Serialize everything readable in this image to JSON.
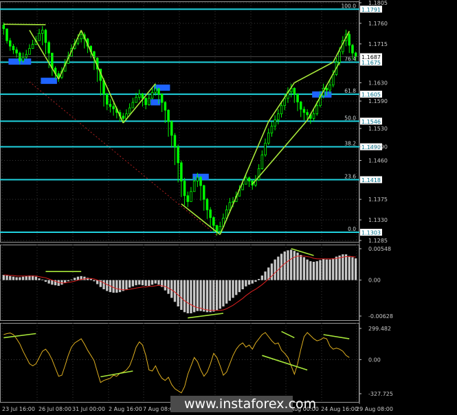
{
  "colors": {
    "background": "#000000",
    "fib_level": "#20d4e0",
    "price_tag_bg": "#ffffff",
    "price_tag_text": "#00708a",
    "candles": "#00ff00",
    "trendlines": "#a8e83a",
    "macd_hist": "#c8c8c8",
    "macd_signal": "#e02020",
    "cci": "#e0b020",
    "block": "#1e64ff"
  },
  "watermark": "www.instaforex.com",
  "chart_data": [
    {
      "type": "candlestick",
      "pane": "price",
      "ylim": [
        1.1285,
        1.1805
      ],
      "y_ticks": [
        "1.1805",
        "1.1760",
        "1.1715",
        "1.1630",
        "1.1590",
        "1.1530",
        "1.1490",
        "1.1460",
        "1.1375",
        "1.1330",
        "1.1285"
      ],
      "x_ticks": [
        "23 Jul 16:00",
        "26 Jul 08:00",
        "31 Jul 00:00",
        "2 Aug 16:00",
        "7 Aug 08:00",
        "9 Aug 16:00",
        "14 Aug 08:00",
        "17 Aug 00:00",
        "22 Aug 00:00",
        "24 Aug 16:00",
        "29 Aug 08:00"
      ],
      "x_tick_labels_visible": [
        "23 Jul 16:00",
        "26 Jul 08:00",
        "31 Jul 00:00",
        "2 Aug 16:00",
        "7 Aug 08:00",
        "2 Aug 00:00",
        "24 Aug 16:00",
        "29 Aug 08:00"
      ],
      "fib_levels": [
        {
          "label": "100.0",
          "price": 1.1791,
          "tag": "1.1791"
        },
        {
          "label": "76.4",
          "price": 1.1675,
          "tag": "1.1675"
        },
        {
          "label": "61.8",
          "price": 1.1605,
          "tag": "1.1605"
        },
        {
          "label": "50.0",
          "price": 1.1546,
          "tag": "1.1546"
        },
        {
          "label": "38.2",
          "price": 1.149,
          "tag": "1.1490"
        },
        {
          "label": "23.6",
          "price": 1.1418,
          "tag": "1.1418"
        },
        {
          "label": "0.0",
          "price": 1.1303,
          "tag": "1.1303"
        }
      ],
      "current_price": {
        "tag": "1.1687",
        "price": 1.1687
      },
      "close_series": [
        1.1748,
        1.1722,
        1.171,
        1.1702,
        1.1695,
        1.1678,
        1.1686,
        1.1692,
        1.1705,
        1.1714,
        1.1722,
        1.1738,
        1.1745,
        1.1718,
        1.1695,
        1.1662,
        1.165,
        1.1642,
        1.1655,
        1.1672,
        1.1688,
        1.1705,
        1.1716,
        1.1726,
        1.1735,
        1.1726,
        1.171,
        1.1698,
        1.1684,
        1.166,
        1.1635,
        1.1605,
        1.1583,
        1.1578,
        1.1573,
        1.1565,
        1.1557,
        1.1552,
        1.1562,
        1.1575,
        1.1587,
        1.1598,
        1.1605,
        1.1596,
        1.1582,
        1.1596,
        1.1609,
        1.1617,
        1.1605,
        1.1587,
        1.157,
        1.1545,
        1.1515,
        1.149,
        1.1455,
        1.1415,
        1.1383,
        1.137,
        1.1392,
        1.1415,
        1.1423,
        1.1405,
        1.1375,
        1.1352,
        1.1335,
        1.1318,
        1.1305,
        1.1316,
        1.1334,
        1.1352,
        1.1368,
        1.137,
        1.1382,
        1.1396,
        1.1408,
        1.1422,
        1.1415,
        1.1406,
        1.1418,
        1.1442,
        1.1472,
        1.1498,
        1.152,
        1.1535,
        1.1549,
        1.1562,
        1.158,
        1.1596,
        1.161,
        1.1618,
        1.1605,
        1.1588,
        1.1572,
        1.1565,
        1.156,
        1.1552,
        1.1562,
        1.158,
        1.1602,
        1.1618,
        1.1614,
        1.1625,
        1.1648,
        1.1675,
        1.1698,
        1.1722,
        1.1736,
        1.1712,
        1.1695,
        1.1688
      ],
      "high_series": [
        1.1762,
        1.1748,
        1.1728,
        1.1715,
        1.1708,
        1.1698,
        1.1696,
        1.1702,
        1.1714,
        1.1724,
        1.1732,
        1.1748,
        1.1754,
        1.1748,
        1.1722,
        1.1695,
        1.1666,
        1.1656,
        1.1664,
        1.1682,
        1.1698,
        1.1714,
        1.1726,
        1.1736,
        1.1745,
        1.174,
        1.1728,
        1.1712,
        1.17,
        1.1686,
        1.166,
        1.164,
        1.1608,
        1.1594,
        1.1586,
        1.1578,
        1.1571,
        1.1564,
        1.1572,
        1.1585,
        1.1597,
        1.1608,
        1.1615,
        1.1608,
        1.1598,
        1.1606,
        1.1619,
        1.1627,
        1.1619,
        1.1607,
        1.159,
        1.1572,
        1.1548,
        1.152,
        1.1495,
        1.146,
        1.1422,
        1.1392,
        1.1402,
        1.1425,
        1.1433,
        1.1426,
        1.1407,
        1.1378,
        1.1358,
        1.1338,
        1.1318,
        1.1326,
        1.1344,
        1.1362,
        1.1378,
        1.138,
        1.1392,
        1.1406,
        1.1418,
        1.1432,
        1.1425,
        1.1418,
        1.1428,
        1.1452,
        1.1482,
        1.1508,
        1.153,
        1.1545,
        1.1559,
        1.1572,
        1.159,
        1.1606,
        1.162,
        1.1628,
        1.162,
        1.1607,
        1.159,
        1.1578,
        1.1572,
        1.1564,
        1.1572,
        1.159,
        1.1612,
        1.1628,
        1.1626,
        1.1635,
        1.1658,
        1.1685,
        1.1708,
        1.1732,
        1.1746,
        1.174,
        1.1715,
        1.1698
      ],
      "low_series": [
        1.1735,
        1.1716,
        1.17,
        1.1693,
        1.1685,
        1.167,
        1.1674,
        1.1682,
        1.1694,
        1.1704,
        1.1712,
        1.1725,
        1.1712,
        1.1692,
        1.1662,
        1.1645,
        1.1638,
        1.1632,
        1.1638,
        1.1658,
        1.1674,
        1.169,
        1.1702,
        1.1712,
        1.1718,
        1.1705,
        1.1695,
        1.1684,
        1.1658,
        1.1632,
        1.1602,
        1.1578,
        1.157,
        1.1565,
        1.1558,
        1.1552,
        1.1545,
        1.1542,
        1.1548,
        1.1562,
        1.1575,
        1.1586,
        1.1592,
        1.1578,
        1.1572,
        1.158,
        1.1594,
        1.1602,
        1.1584,
        1.1566,
        1.1542,
        1.1512,
        1.1488,
        1.145,
        1.1412,
        1.138,
        1.1362,
        1.1358,
        1.137,
        1.1392,
        1.1402,
        1.1372,
        1.135,
        1.1332,
        1.1315,
        1.1303,
        1.1296,
        1.1302,
        1.1312,
        1.1328,
        1.1345,
        1.1358,
        1.137,
        1.1382,
        1.1395,
        1.1408,
        1.1402,
        1.1396,
        1.1402,
        1.1415,
        1.144,
        1.1468,
        1.1494,
        1.1512,
        1.1526,
        1.1539,
        1.1554,
        1.157,
        1.1586,
        1.1598,
        1.1586,
        1.1568,
        1.1555,
        1.1548,
        1.1546,
        1.154,
        1.1546,
        1.1558,
        1.1576,
        1.1596,
        1.1602,
        1.1606,
        1.162,
        1.1645,
        1.1668,
        1.1692,
        1.171,
        1.1695,
        1.1682,
        1.1678
      ]
    },
    {
      "type": "bar",
      "pane": "macd",
      "ylim": [
        -0.00628,
        0.00548
      ],
      "y_ticks": [
        "0.00548",
        "0.00",
        "-0.00628"
      ],
      "histogram": [
        0.0009,
        0.0008,
        0.0007,
        0.0006,
        0.0005,
        0.0005,
        0.0006,
        0.0007,
        0.0008,
        0.0008,
        0.0006,
        0.0003,
        0.0001,
        -0.0003,
        -0.0006,
        -0.0008,
        -0.0009,
        -0.001,
        -0.0008,
        -0.0005,
        -0.0002,
        0.0001,
        0.0004,
        0.0006,
        0.0007,
        0.0006,
        0.0004,
        0.0002,
        -0.0002,
        -0.0007,
        -0.0012,
        -0.0016,
        -0.0019,
        -0.0021,
        -0.0022,
        -0.0022,
        -0.0021,
        -0.0019,
        -0.0016,
        -0.0013,
        -0.0011,
        -0.0009,
        -0.0008,
        -0.0009,
        -0.001,
        -0.001,
        -0.0008,
        -0.0006,
        -0.0008,
        -0.0012,
        -0.0018,
        -0.0024,
        -0.0031,
        -0.0038,
        -0.0046,
        -0.0052,
        -0.0056,
        -0.0058,
        -0.0058,
        -0.0056,
        -0.0054,
        -0.0054,
        -0.0055,
        -0.0056,
        -0.0056,
        -0.0055,
        -0.0053,
        -0.005,
        -0.0046,
        -0.0041,
        -0.0036,
        -0.0031,
        -0.0026,
        -0.0021,
        -0.0016,
        -0.0011,
        -0.0008,
        -0.0006,
        -0.0003,
        0.0002,
        0.0008,
        0.0015,
        0.0022,
        0.0029,
        0.0036,
        0.0041,
        0.0046,
        0.005,
        0.0052,
        0.0053,
        0.0051,
        0.0048,
        0.0044,
        0.004,
        0.0036,
        0.0033,
        0.0032,
        0.0033,
        0.0035,
        0.0037,
        0.0036,
        0.0036,
        0.0038,
        0.0041,
        0.0043,
        0.0045,
        0.0045,
        0.0042,
        0.004,
        0.0038
      ],
      "signal": [
        0.0009,
        0.0009,
        0.0008,
        0.0008,
        0.0007,
        0.0007,
        0.0007,
        0.0007,
        0.0007,
        0.0007,
        0.0007,
        0.0006,
        0.0005,
        0.0004,
        0.0002,
        0.0,
        -0.0002,
        -0.0004,
        -0.0005,
        -0.0005,
        -0.0004,
        -0.0003,
        -0.0002,
        0.0,
        0.0001,
        0.0002,
        0.0003,
        0.0003,
        0.0002,
        0.0,
        -0.0002,
        -0.0005,
        -0.0008,
        -0.001,
        -0.0013,
        -0.0015,
        -0.0016,
        -0.0017,
        -0.0017,
        -0.0016,
        -0.0015,
        -0.0014,
        -0.0013,
        -0.0012,
        -0.0012,
        -0.0011,
        -0.0011,
        -0.001,
        -0.0009,
        -0.001,
        -0.0011,
        -0.0014,
        -0.0017,
        -0.0021,
        -0.0026,
        -0.0031,
        -0.0036,
        -0.004,
        -0.0043,
        -0.0046,
        -0.0048,
        -0.0049,
        -0.0051,
        -0.0052,
        -0.0053,
        -0.0053,
        -0.0053,
        -0.0053,
        -0.0052,
        -0.005,
        -0.0047,
        -0.0044,
        -0.004,
        -0.0036,
        -0.0032,
        -0.0027,
        -0.0023,
        -0.0019,
        -0.0016,
        -0.0012,
        -0.0008,
        -0.0003,
        0.0002,
        0.0007,
        0.0013,
        0.0018,
        0.0024,
        0.0029,
        0.0033,
        0.0037,
        0.004,
        0.0042,
        0.0042,
        0.0042,
        0.0041,
        0.004,
        0.0038,
        0.0037,
        0.0037,
        0.0037,
        0.0037,
        0.0037,
        0.0037,
        0.0038,
        0.0039,
        0.004,
        0.0041,
        0.0041,
        0.0041,
        0.004
      ]
    },
    {
      "type": "line",
      "pane": "cci",
      "ylim": [
        -327.725,
        299.482
      ],
      "y_ticks": [
        "299.482",
        "0.00",
        "-327.725"
      ],
      "values": [
        240,
        250,
        255,
        240,
        200,
        150,
        80,
        20,
        -40,
        -60,
        -40,
        20,
        80,
        100,
        60,
        0,
        -80,
        -160,
        -150,
        -60,
        40,
        120,
        160,
        180,
        200,
        150,
        90,
        40,
        -10,
        -120,
        -220,
        -200,
        -190,
        -180,
        -150,
        -160,
        -130,
        -120,
        -100,
        -60,
        20,
        120,
        170,
        140,
        40,
        -100,
        -110,
        -60,
        -130,
        -180,
        -200,
        -170,
        -240,
        -280,
        -300,
        -320,
        -260,
        -140,
        -60,
        20,
        -20,
        -100,
        -160,
        -120,
        -40,
        60,
        20,
        -60,
        -150,
        -120,
        -40,
        40,
        100,
        140,
        160,
        120,
        140,
        100,
        160,
        200,
        240,
        260,
        220,
        180,
        150,
        160,
        90,
        60,
        20,
        -60,
        -140,
        -40,
        100,
        220,
        260,
        230,
        200,
        180,
        190,
        210,
        200,
        130,
        100,
        110,
        100,
        80,
        40,
        20
      ]
    }
  ],
  "overlays": {
    "trendlines": [
      [
        [
          0,
          1.1758
        ],
        [
          13,
          1.1757
        ]
      ],
      [
        [
          8,
          1.1745
        ],
        [
          17,
          1.1638
        ]
      ],
      [
        [
          17,
          1.1638
        ],
        [
          24,
          1.1745
        ]
      ],
      [
        [
          24,
          1.1745
        ],
        [
          37,
          1.1542
        ]
      ],
      [
        [
          37,
          1.1542
        ],
        [
          47,
          1.1628
        ]
      ],
      [
        [
          55,
          1.1365
        ],
        [
          67,
          1.1298
        ]
      ],
      [
        [
          67,
          1.1298
        ],
        [
          82,
          1.1545
        ]
      ],
      [
        [
          82,
          1.1545
        ],
        [
          90,
          1.163
        ]
      ],
      [
        [
          77,
          1.1408
        ],
        [
          94,
          1.1548
        ]
      ],
      [
        [
          94,
          1.1548
        ],
        [
          104,
          1.1675
        ]
      ],
      [
        [
          90,
          1.163
        ],
        [
          102,
          1.1675
        ]
      ],
      [
        [
          102,
          1.1675
        ],
        [
          107,
          1.1743
        ]
      ]
    ],
    "macd_lines": [
      [
        [
          13,
          0.0015
        ],
        [
          24,
          0.0015
        ]
      ],
      [
        [
          57,
          -0.0066
        ],
        [
          68,
          -0.0058
        ]
      ],
      [
        [
          89,
          0.0055
        ],
        [
          96,
          0.0043
        ]
      ]
    ],
    "cci_lines": [
      [
        [
          0,
          210
        ],
        [
          10,
          250
        ]
      ],
      [
        [
          30,
          -165
        ],
        [
          40,
          -110
        ]
      ],
      [
        [
          86,
          270
        ],
        [
          90,
          210
        ]
      ],
      [
        [
          80,
          40
        ],
        [
          94,
          -100
        ]
      ],
      [
        [
          99,
          240
        ],
        [
          107,
          200
        ]
      ]
    ],
    "blocks": [
      {
        "c0": 2,
        "c1": 8,
        "p": 1.1677
      },
      {
        "c0": 12,
        "c1": 16,
        "p": 1.1635
      },
      {
        "c0": 47,
        "c1": 51,
        "p": 1.162
      },
      {
        "c0": 46,
        "c1": 48,
        "p": 1.1588
      },
      {
        "c0": 59,
        "c1": 63,
        "p": 1.1425
      },
      {
        "c0": 96,
        "c1": 101,
        "p": 1.1605
      }
    ]
  }
}
